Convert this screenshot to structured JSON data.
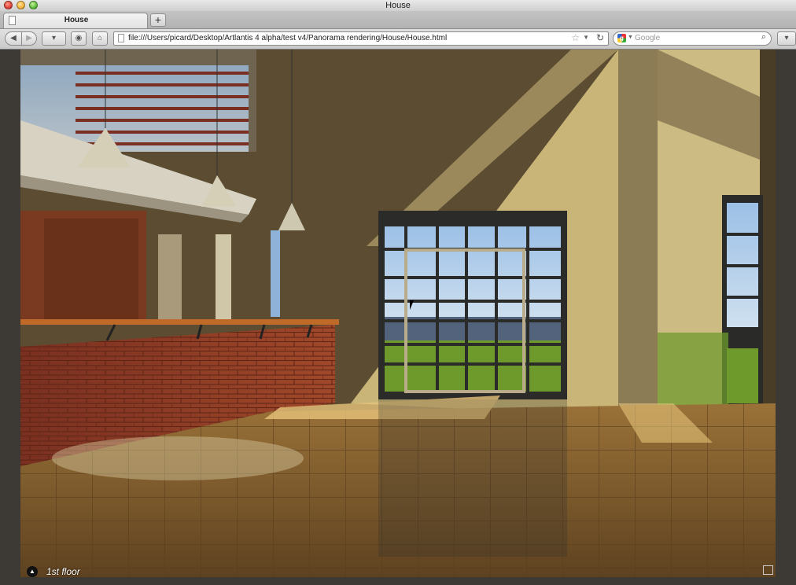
{
  "window": {
    "title": "House"
  },
  "tabs": [
    {
      "label": "House"
    }
  ],
  "toolbar": {
    "new_tab_label": "+",
    "back_icon": "◀",
    "forward_icon": "▶",
    "bookmark_icon": "▾",
    "reader_icon": "◉",
    "home_icon": "⌂",
    "ext_icon": "▾"
  },
  "address": {
    "url": "file:///Users/picard/Desktop/Artlantis 4 alpha/test v4/Panorama rendering/House/House.html"
  },
  "search": {
    "placeholder": "Google"
  },
  "viewer": {
    "floor_label": "1st floor",
    "up_icon": "▲"
  },
  "colors": {
    "wall_shadow": "#5a4c33",
    "wall_sunlit": "#c9b679",
    "brick": "#8a3a22",
    "floor": "#8a6534",
    "sky": "#8fb3d8",
    "grass": "#6e9a2c"
  }
}
